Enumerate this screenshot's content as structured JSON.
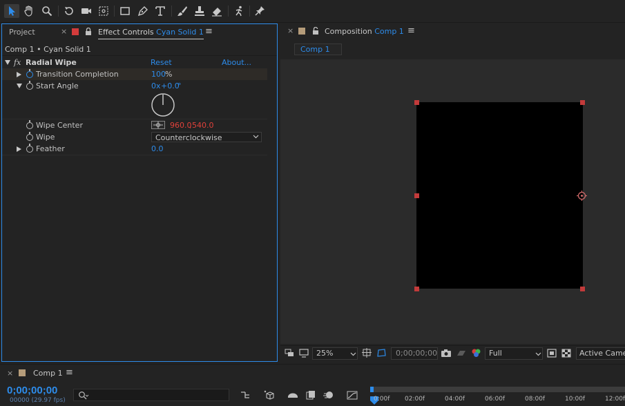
{
  "toolbar": {
    "tools": [
      "selection-tool",
      "hand-tool",
      "zoom-tool",
      "rotate-tool",
      "camera-tool",
      "pan-behind-tool",
      "rectangle-tool",
      "pen-tool",
      "type-tool",
      "brush-tool",
      "clone-stamp-tool",
      "eraser-tool",
      "roto-brush-tool",
      "puppet-pin-tool"
    ]
  },
  "effect_controls": {
    "project_tab": "Project",
    "tab_label": "Effect Controls",
    "tab_layer": "Cyan Solid 1",
    "breadcrumb": "Comp 1 • Cyan Solid 1",
    "effect_name": "Radial Wipe",
    "fx": "fx",
    "reset": "Reset",
    "about": "About...",
    "props": {
      "transition_label": "Transition Completion",
      "transition_value": "100",
      "transition_unit": "%",
      "start_angle_label": "Start Angle",
      "start_angle_rev": "0x",
      "start_angle_deg": "+0.0",
      "start_angle_unit": "°",
      "wipe_center_label": "Wipe Center",
      "wipe_center_x": "960.0",
      "wipe_center_sep": ",",
      "wipe_center_y": "540.0",
      "wipe_label": "Wipe",
      "wipe_value": "Counterclockwise",
      "feather_label": "Feather",
      "feather_value": "0.0"
    }
  },
  "composition": {
    "tab_label": "Composition",
    "tab_comp": "Comp 1",
    "flow_tab": "Comp 1",
    "zoom": "25%",
    "timecode": "0;00;00;00",
    "resolution": "Full",
    "camera": "Active Camer"
  },
  "timeline": {
    "tab": "Comp 1",
    "timecode": "0;00;00;00",
    "fps": "00000 (29.97 fps)",
    "search_placeholder": "",
    "ruler": [
      "0:00f",
      "02:00f",
      "04:00f",
      "06:00f",
      "08:00f",
      "10:00f",
      "12:00f"
    ]
  },
  "colors": {
    "accent": "#2d8ceb",
    "panel": "#232323",
    "viewer_bg": "#2b2b2b",
    "handle": "#c23a3a",
    "value_red": "#e0413a"
  }
}
